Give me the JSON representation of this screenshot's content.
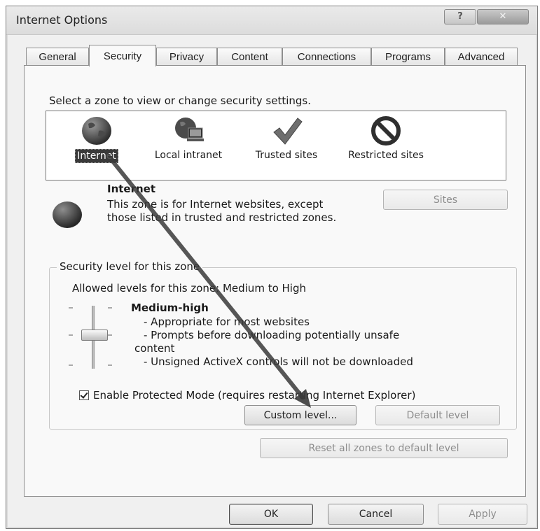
{
  "window": {
    "title": "Internet Options",
    "help_button": "?",
    "close_button": "✕"
  },
  "tabs": [
    {
      "label": "General",
      "active": false
    },
    {
      "label": "Security",
      "active": true
    },
    {
      "label": "Privacy",
      "active": false
    },
    {
      "label": "Content",
      "active": false
    },
    {
      "label": "Connections",
      "active": false
    },
    {
      "label": "Programs",
      "active": false
    },
    {
      "label": "Advanced",
      "active": false
    }
  ],
  "zones": {
    "prompt": "Select a zone to view or change security settings.",
    "items": [
      {
        "label": "Internet",
        "icon": "globe-icon",
        "selected": true
      },
      {
        "label": "Local intranet",
        "icon": "intranet-icon",
        "selected": false
      },
      {
        "label": "Trusted sites",
        "icon": "checkmark-icon",
        "selected": false
      },
      {
        "label": "Restricted sites",
        "icon": "no-entry-icon",
        "selected": false
      }
    ]
  },
  "zone_info": {
    "title": "Internet",
    "description": "This zone is for Internet websites, except those listed in trusted and restricted zones.",
    "sites_button": "Sites"
  },
  "security_level": {
    "legend": "Security level for this zone",
    "allowed": "Allowed levels for this zone: Medium to High",
    "level_name": "Medium-high",
    "details": [
      "- Appropriate for most websites",
      "- Prompts before downloading potentially unsafe",
      "content",
      "- Unsigned ActiveX controls will not be downloaded"
    ],
    "protected_mode_label": "Enable Protected Mode (requires restarting Internet Explorer)",
    "protected_mode_checked": true,
    "custom_level_button": "Custom level...",
    "default_level_button": "Default level"
  },
  "reset_all_button": "Reset all zones to default level",
  "footer": {
    "ok": "OK",
    "cancel": "Cancel",
    "apply": "Apply"
  },
  "colors": {
    "selection": "#3a3a3a",
    "panel": "#f9f9f9",
    "arrow": "#3a3a3a"
  }
}
